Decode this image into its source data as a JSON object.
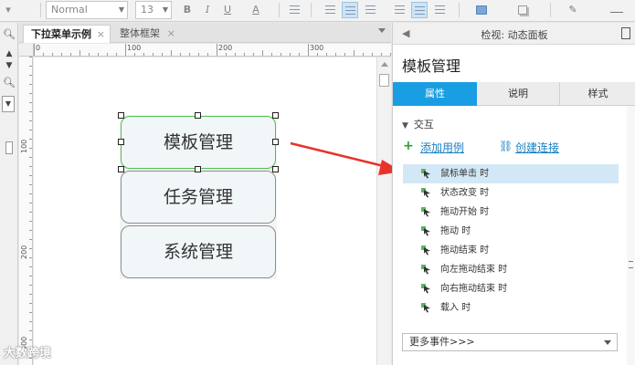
{
  "toolbar": {
    "style_value": "Normal",
    "font_size_value": "13",
    "bold_label": "B",
    "italic_label": "I",
    "underline_label": "U",
    "text_color_label": "A"
  },
  "tabs": [
    {
      "label": "下拉菜单示例",
      "active": true
    },
    {
      "label": "整体框架",
      "active": false
    }
  ],
  "tab_close_glyph": "×",
  "ruler": {
    "h_labels": [
      "0",
      "100",
      "200",
      "300"
    ],
    "v_labels": [
      "100",
      "200",
      "300"
    ]
  },
  "canvas": {
    "menu_items": [
      "模板管理",
      "任务管理",
      "系统管理"
    ],
    "selected_index": 0
  },
  "inspector": {
    "header_title": "检视: 动态面板",
    "widget_name": "模板管理",
    "tabs": [
      "属性",
      "说明",
      "样式"
    ],
    "active_tab": 0,
    "section_title": "交互",
    "add_case_label": "添加用例",
    "create_link_label": "创建连接",
    "events": [
      {
        "label": "鼠标单击 时",
        "highlighted": true
      },
      {
        "label": "状态改变 时",
        "highlighted": false
      },
      {
        "label": "拖动开始 时",
        "highlighted": false
      },
      {
        "label": "拖动 时",
        "highlighted": false
      },
      {
        "label": "拖动结束 时",
        "highlighted": false
      },
      {
        "label": "向左拖动结束 时",
        "highlighted": false
      },
      {
        "label": "向右拖动结束 时",
        "highlighted": false
      },
      {
        "label": "载入 时",
        "highlighted": false
      }
    ],
    "more_events_label": "更多事件>>>"
  },
  "watermark": "大数跨境",
  "colors": {
    "accent": "#1a9ee3",
    "link": "#1a7fc1",
    "selection_border": "#4fbf4f",
    "arrow": "#e8332a",
    "event_highlight": "#d2e8f7"
  }
}
